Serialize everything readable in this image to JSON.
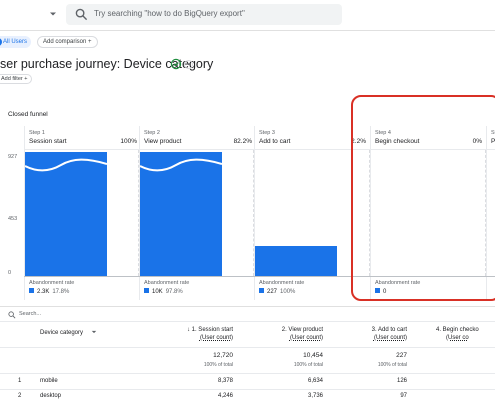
{
  "search": {
    "placeholder": "Try searching \"how to do BigQuery export\""
  },
  "chips": {
    "segment": "All Users",
    "add_comparison": "Add comparison"
  },
  "page": {
    "title": "ser purchase journey: Device category",
    "add_filter": "Add filter"
  },
  "funnel": {
    "section_label": "Closed funnel",
    "y_ticks": [
      "927",
      "453",
      "0"
    ],
    "steps": [
      {
        "step_label": "Step 1",
        "name": "Session start",
        "percent": "100%",
        "abandonment_label": "Abandonment rate",
        "abandonment_count": "2.3K",
        "abandonment_rate": "17.8%"
      },
      {
        "step_label": "Step 2",
        "name": "View product",
        "percent": "82.2%",
        "abandonment_label": "Abandonment rate",
        "abandonment_count": "10K",
        "abandonment_rate": "97.8%"
      },
      {
        "step_label": "Step 3",
        "name": "Add to cart",
        "percent": "2.2%",
        "abandonment_label": "Abandonment rate",
        "abandonment_count": "227",
        "abandonment_rate": "100%"
      },
      {
        "step_label": "Step 4",
        "name": "Begin checkout",
        "percent": "0%",
        "abandonment_label": "Abandonment rate",
        "abandonment_count": "0",
        "abandonment_rate": ""
      },
      {
        "step_label": "St",
        "name": "Pu",
        "percent": "",
        "abandonment_label": "",
        "abandonment_count": "",
        "abandonment_rate": ""
      }
    ]
  },
  "table": {
    "search_placeholder": "Search...",
    "dimension_header": "Device category",
    "columns": [
      {
        "title": "1. Session start",
        "metric": "(User count)",
        "total": "12,720",
        "share": "100% of total",
        "sorted": "↓"
      },
      {
        "title": "2. View product",
        "metric": "(User count)",
        "total": "10,454",
        "share": "100% of total",
        "sorted": ""
      },
      {
        "title": "3. Add to cart",
        "metric": "(User count)",
        "total": "227",
        "share": "100% of total",
        "sorted": ""
      },
      {
        "title": "4. Begin checko",
        "metric": "(User co",
        "total": "",
        "share": "",
        "sorted": ""
      }
    ],
    "rows": [
      {
        "index": "1",
        "device": "mobile",
        "values": [
          "8,378",
          "6,634",
          "126"
        ]
      },
      {
        "index": "2",
        "device": "desktop",
        "values": [
          "4,246",
          "3,736",
          "97"
        ]
      }
    ]
  },
  "colors": {
    "accent": "#1a73e8",
    "highlight": "#d93025",
    "success": "#1e8e3e"
  }
}
